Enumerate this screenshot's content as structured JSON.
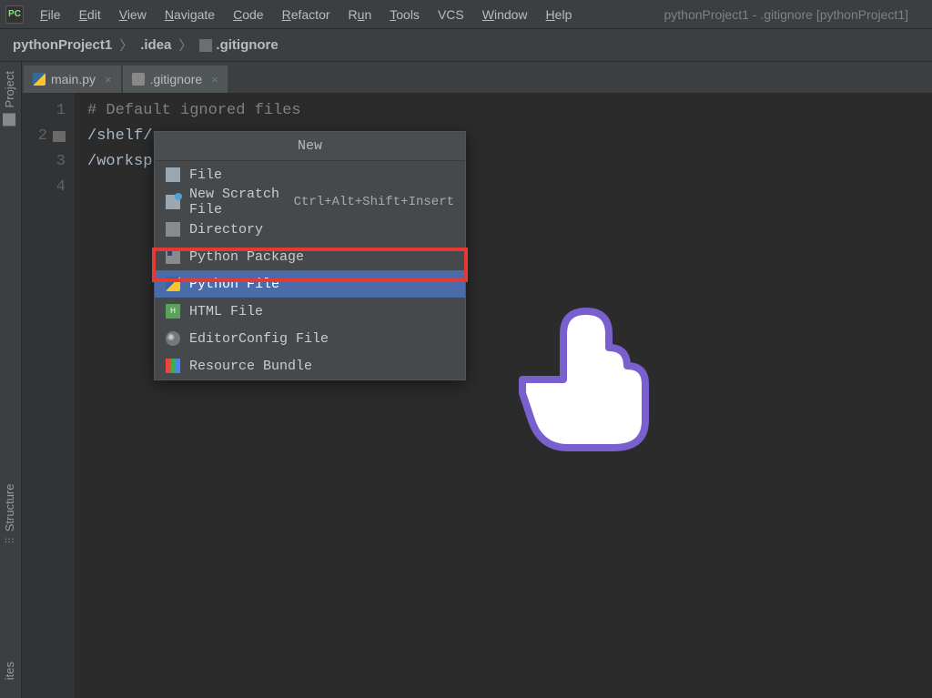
{
  "app_icon_text": "PC",
  "menu": {
    "file": "File",
    "edit": "Edit",
    "view": "View",
    "navigate": "Navigate",
    "code": "Code",
    "refactor": "Refactor",
    "run": "Run",
    "tools": "Tools",
    "vcs": "VCS",
    "window": "Window",
    "help": "Help"
  },
  "window_title": "pythonProject1 - .gitignore [pythonProject1]",
  "breadcrumb": {
    "project": "pythonProject1",
    "folder": ".idea",
    "file": ".gitignore"
  },
  "side": {
    "project": "Project",
    "structure": "Structure",
    "favorites": "ites"
  },
  "tabs": {
    "tab1": "main.py",
    "tab2": ".gitignore"
  },
  "gutter": [
    "1",
    "2",
    "3",
    "4"
  ],
  "code": {
    "l1": "# Default ignored files",
    "l2": "/shelf/",
    "l3": "/worksp"
  },
  "context_menu": {
    "title": "New",
    "file": "File",
    "scratch": "New Scratch File",
    "scratch_shortcut": "Ctrl+Alt+Shift+Insert",
    "directory": "Directory",
    "package": "Python Package",
    "pyfile": "Python File",
    "html": "HTML File",
    "editorconfig": "EditorConfig File",
    "resource": "Resource Bundle"
  }
}
